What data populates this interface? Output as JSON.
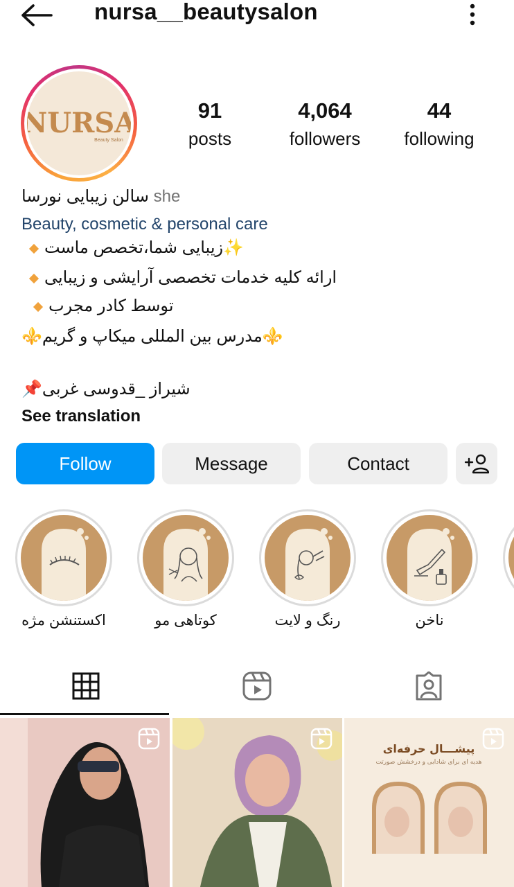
{
  "header": {
    "username": "nursa__beautysalon",
    "back_icon": "arrow-left-icon",
    "menu_icon": "more-vertical-icon"
  },
  "profile": {
    "avatar_logo_text": "NURSA",
    "avatar_logo_subtext": "Beauty Salon",
    "stats": {
      "posts_count": "91",
      "posts_label": "posts",
      "followers_count": "4,064",
      "followers_label": "followers",
      "following_count": "44",
      "following_label": "following"
    }
  },
  "bio": {
    "name": "سالن زیبایی نورسا",
    "pronoun": "she",
    "category": "Beauty, cosmetic & personal care",
    "line1": "✨زیبایی شما،تخصص ماست",
    "line2": "ارائه کلیه خدمات تخصصی آرایشی و زیبایی",
    "line3": "توسط کادر مجرب",
    "line4": "⚜️مدرس بین المللی میکاپ و گریم⚜️",
    "line5": "شیراز _قدوسی غربی📌",
    "see_translation": "See translation"
  },
  "actions": {
    "follow": "Follow",
    "message": "Message",
    "contact": "Contact",
    "add_user_icon": "add-user-icon"
  },
  "highlights": [
    {
      "label": "اکستنشن مژه",
      "icon": "eyelash-icon"
    },
    {
      "label": "کوتاهی مو",
      "icon": "haircut-icon"
    },
    {
      "label": "رنگ و لایت",
      "icon": "hair-color-icon"
    },
    {
      "label": "ناخن",
      "icon": "nail-polish-icon"
    }
  ],
  "tabs": [
    {
      "name": "posts",
      "icon": "grid-icon",
      "active": true
    },
    {
      "name": "reels",
      "icon": "reels-icon",
      "active": false
    },
    {
      "name": "tagged",
      "icon": "tagged-user-icon",
      "active": false
    }
  ],
  "grid_posts": {
    "post3_title": "پیشـــال حرفه‌ای",
    "post3_subtitle": "هدیه ای برای شادابی و درخشش صورتت"
  },
  "colors": {
    "follow_blue": "#0095f6",
    "category_blue": "#23456b",
    "highlight_tan": "#c79a67",
    "button_gray": "#efefef"
  }
}
